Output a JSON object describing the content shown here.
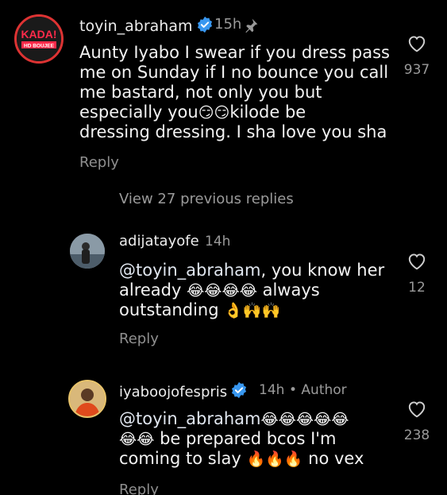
{
  "comments": [
    {
      "username": "toyin_abraham",
      "verified": true,
      "time": "15h",
      "pinned": true,
      "avatar_label": "KADA!",
      "avatar_sublabel": "HD BOUJEE",
      "text_lines": [
        "Aunty Iyabo I swear if you dress pass",
        "me on Sunday if I no bounce you call",
        "me bastard, not only you but"
      ],
      "line4_a": "especially you",
      "line4_emoji": "😏😏",
      "line4_b": "kilode be",
      "line5": "dressing dressing. I sha love you sha",
      "reply_label": "Reply",
      "likes": "937"
    },
    {
      "username": "adijatayofe",
      "time": "14h",
      "mention": "@toyin_abraham",
      "text_a": ", you know her",
      "text_b1": "already ",
      "text_b_emoji": "😂😂😂😂",
      "text_b2": " always",
      "text_c": "outstanding ",
      "text_c_emoji": "👌🙌🙌",
      "reply_label": "Reply",
      "likes": "12"
    },
    {
      "username": "iyaboojofespris",
      "verified": true,
      "time": "14h",
      "author_tag": "• Author",
      "mention": "@toyin_abraham",
      "mention_emoji": " 😂😂😂😂😂",
      "line2_emoji": "😂😂",
      "line2_text": " be prepared bcos I'm",
      "line3_text": "coming to slay ",
      "line3_emoji": "🔥🔥🔥",
      "line3_tail": " no vex",
      "reply_label": "Reply",
      "likes": "238"
    }
  ],
  "view_previous": "View 27 previous replies",
  "colors": {
    "background": "#000000",
    "text": "#f2f2f2",
    "muted": "#9a9a9a",
    "verified": "#3897f0"
  }
}
